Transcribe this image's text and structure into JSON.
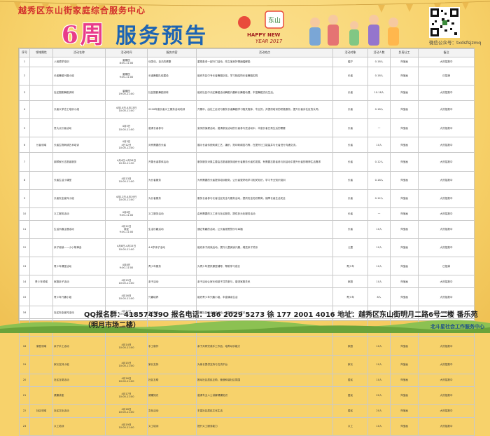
{
  "header": {
    "center_name": "越秀区东山街家庭综合服务中心",
    "week_title_num": "6周",
    "week_title_rest": " 服务预告",
    "logo_caption": "HAPPY NEW",
    "logo_year": "YEAR 2017",
    "logo_chars": "东山",
    "wechat_label": "微信公众号：",
    "wechat_id": "txdsfsjzmq"
  },
  "table": {
    "headers": [
      "序号",
      "领域属性",
      "活动名称",
      "活动时间",
      "服务内容",
      "活动地点",
      "",
      "活动对象",
      "活动人数",
      "负责社工",
      "备注"
    ],
    "rows": [
      [
        "1",
        "",
        "八段锦学培训",
        "星期四\n8:00-11:00",
        "动发化、自己的健康",
        "重视各老一起行门活动，改立宝良好情绪幅解能",
        "舞左前",
        "幅宁",
        "0-18人",
        "萍宝画",
        "大热招报中"
      ],
      [
        "2",
        "",
        "长者舞蹈兴趣小组",
        "星期四\n9:00-11:00",
        "长者舞蹈队伍建设",
        "组织东区中专长者舞蹈队伍，学习相结构长者舞蹈实践",
        "中心兴趣小组",
        "长者",
        "0-18人",
        "萍宝画",
        "已招满"
      ],
      [
        "3",
        "",
        "社区摄影舞蹈训练",
        "星期四\n19:00-21:00",
        "社区摄影舞蹈训练",
        "组织社区中长区舞蹈活动舞蹈兴趣和长舞蹈动展，丰富舞蹈文化生活。",
        "蕃长街社区",
        "长者",
        "10-18人",
        "萍宝画",
        "大热招报中"
      ],
      [
        "4",
        "",
        "长者义学志工培训小组",
        "4月10日-4月13日\n10:00-11:00",
        "2016年度长者义工服务活动培训",
        "开展中，由社工走访与服务长者舞蹈学习相关程序、专业的，并提供培训的积极服务，提升长者对社区的认同。",
        "街道长者之家",
        "长者",
        "0-18人",
        "萍宝画",
        "大热招报中"
      ],
      [
        "5",
        "",
        "意大点长者活动",
        "4月5日\n10:00-11:00",
        "邀请长者参与",
        "宣传的保健活动，邀请参加活动的长者参与进活动中，丰富长者日常生活的需要",
        "中心多功能室",
        "长者",
        "一",
        "萍宝画",
        "大热招报中"
      ],
      [
        "6",
        "长者领域",
        "长者生物刺绣艺术培训",
        "4月3日\n4日12日\n10:00-12:00",
        "对有需要的长者",
        "展示长者传统刺绣工艺，编织、拓印刺绣技巧等，在提升社工能量并与长者进行沟通交流。",
        "五羊新广场",
        "长者",
        "10人",
        "萍宝画",
        "大热招报中"
      ],
      [
        "7",
        "",
        "钢琴家长志愿者服务",
        "4月4日-4月26日\n10:30-11:30",
        "开展长者群体活动",
        "服务服务对象主要由志愿者服务组织长者服务长者的发展，有需要志愿者参与到活动中提升长者的精神生活需求",
        "中心多功能室",
        "长者",
        "0-12人",
        "萍宝画",
        "大热招报中"
      ],
      [
        "8",
        "",
        "长者生活小课堂",
        "4月13日\n10:00-11:00",
        "为长者服务",
        "为有需要的长者提供培训服务，让长者更好地学习相关知识，学习专业知识培训",
        "幸福家园之家",
        "长者",
        "0-18人",
        "萍宝画",
        "大热招报中"
      ],
      [
        "9",
        "",
        "长者安全宣传小组",
        "4月12日-4月19日\n10:00-11:00",
        "为长者服务",
        "服务长者参与长者社区安全与服务活动，提供安全知识教育，保障长者生活安全",
        "街道长者之家",
        "长者",
        "0-12人",
        "萍宝画",
        "大热招报中"
      ],
      [
        "10",
        "",
        "义工服务活动",
        "4月8日\n9:00-11:00",
        "义工服务活动",
        "由有需要的义工参与社区服务，提供多元化服务活动",
        "社区街坊",
        "长者",
        "一",
        "萍宝画",
        "大热招报中"
      ],
      [
        "11",
        "",
        "生活乐趣主题活动",
        "4月12日\n待定\n9:00-11:00",
        "生活乐趣活动",
        "通过有趣的活动，让长者感受快乐与幸福",
        "中心多功能室",
        "长者",
        "10人",
        "萍宝画",
        "大热招报中"
      ],
      [
        "12",
        "",
        "亲子阅读——小小故事会",
        "4月8日-4月15日\n10:00-11:00",
        "4-6岁亲子活动",
        "组织亲子阅读活动，提升儿童阅读兴趣，增进亲子关系",
        "中心多功能室",
        "儿童",
        "10人",
        "萍宝画",
        "大热招报中"
      ],
      [
        "13",
        "",
        "青少年课堂活动",
        "4月8日\n9:00-11:00",
        "青少年服务",
        "为青少年提供课堂辅导，帮助学习成长",
        "中心多功能室",
        "青少年",
        "10人",
        "萍宝画",
        "已招满"
      ],
      [
        "14",
        "青少年领域",
        "家庭亲子活动",
        "4月15日\n10:00-11:00",
        "亲子活动",
        "亲子活动让家长和孩子共同参与，增进家庭关系",
        "社区街坊",
        "家庭",
        "10人",
        "萍宝画",
        "大热招报中"
      ],
      [
        "15",
        "",
        "青少年兴趣小组",
        "4月16日\n10:00-11:00",
        "兴趣培养",
        "组织青少年兴趣小组，丰富课余生活",
        "中心多功能室",
        "青少年",
        "8人",
        "萍宝画",
        "大热招报中"
      ],
      [
        "16",
        "",
        "社区安全宣传活动",
        "4月12日\n10:00-11:00",
        "安全教育",
        "开展社区安全宣传活动，提高居民安全意识",
        "社区街坊",
        "居民",
        "10人",
        "萍宝画",
        "大热招报中"
      ],
      [
        "17",
        "",
        "家庭关系工作坊",
        "4月13日\n10:00-11:00",
        "家庭服务",
        "通过工作坊形式帮助家庭改善关系",
        "中心多功能室",
        "家庭",
        "10人",
        "萍宝画",
        "大热招报中"
      ],
      [
        "18",
        "家庭领域",
        "亲子手工活动",
        "4月14日\n10:00-11:00",
        "手工制作",
        "亲子共同完成手工作品，培养动手能力",
        "中心多功能室",
        "家庭",
        "10人",
        "萍宝画",
        "大热招报中"
      ],
      [
        "19",
        "",
        "家长支持小组",
        "4月15日\n10:00-11:00",
        "家长支持",
        "为家长提供支持与交流平台",
        "中心多功能室",
        "家长",
        "10人",
        "萍宝画",
        "大热招报中"
      ],
      [
        "20",
        "",
        "社区互助活动",
        "4月16日\n10:00-11:00",
        "社区互助",
        "推动社区居民互助，营造和谐社区氛围",
        "社区街坊",
        "居民",
        "10人",
        "萍宝画",
        "大热招报中"
      ],
      [
        "21",
        "",
        "健康讲座",
        "4月17日\n10:00-11:00",
        "健康知识",
        "邀请专业人士讲解健康知识",
        "中心多功能室",
        "居民",
        "20人",
        "萍宝画",
        "大热招报中"
      ],
      [
        "22",
        "社区领域",
        "社区文化活动",
        "4月18日\n10:00-11:00",
        "文化活动",
        "丰富社区居民文化生活",
        "社区街坊",
        "居民",
        "20人",
        "萍宝画",
        "大热招报中"
      ],
      [
        "23",
        "",
        "义工培训",
        "4月19日\n10:00-11:00",
        "义工培训",
        "提升义工服务能力",
        "中心多功能室",
        "义工",
        "10人",
        "萍宝画",
        "大热招报中"
      ]
    ]
  },
  "footer": {
    "text": "QQ报名群：41857439O 报名电话：186 2029 5273 徐 177 2001 4016 地址：越秀区东山街明月二路6号二楼 番乐苑（明月市场二楼）",
    "brand": "北斗星社会工作服务中心"
  }
}
